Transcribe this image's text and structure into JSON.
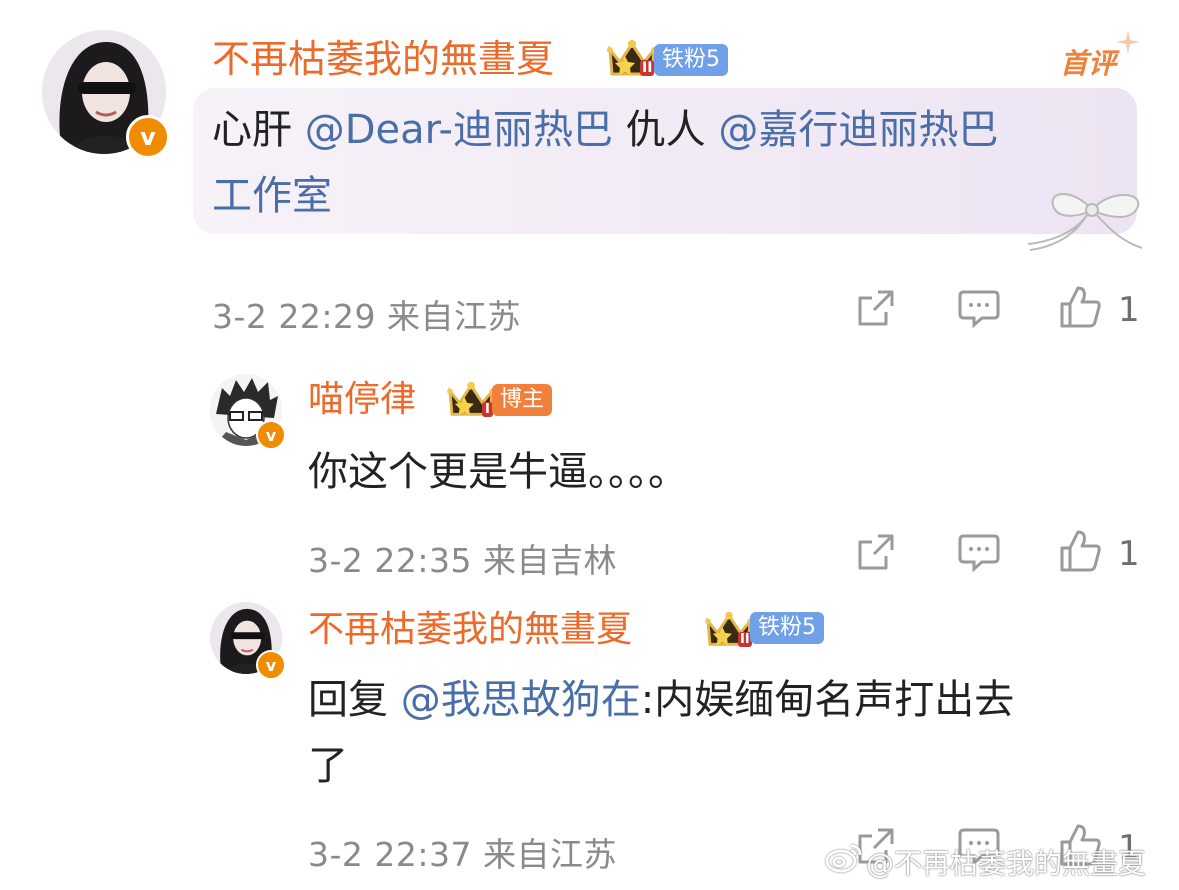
{
  "comments": [
    {
      "username": "不再枯萎我的無畫夏",
      "fan_badge": "铁粉5",
      "first_label": "首评",
      "text_prefix": "心肝 ",
      "mention1": "@Dear-迪丽热巴",
      "text_mid": " 仇人 ",
      "mention2": "@嘉行迪丽热巴",
      "mention2_cont": "工作室",
      "meta": "3-2 22:29 来自江苏",
      "like_count": "1"
    },
    {
      "username": "喵停律",
      "fan_badge": "博主",
      "text": "你这个更是牛逼。。。。",
      "meta": "3-2 22:35 来自吉林",
      "like_count": "1"
    },
    {
      "username": "不再枯萎我的無畫夏",
      "fan_badge": "铁粉5",
      "reply_prefix": "回复 ",
      "mention": "@我思故狗在",
      "text_line1": ":内娱缅甸名声打出去",
      "text_line2": "了",
      "meta": "3-2 22:37 来自江苏",
      "like_count": "1"
    }
  ],
  "verified_mark": "v",
  "crown_level": "II",
  "crown_level_small": "I",
  "watermark": "@不再枯萎我的無畫夏",
  "icons": [
    "share-icon",
    "comment-icon",
    "like-icon",
    "crown-icon",
    "verified-icon",
    "weibo-logo-icon",
    "bow-decoration-icon"
  ],
  "colors": {
    "username": "#ec6a2a",
    "mention": "#4a6ea8",
    "fan_badge_blue": "#6fa0e8",
    "blogger_badge": "#f0803a",
    "verified": "#f08c00"
  }
}
